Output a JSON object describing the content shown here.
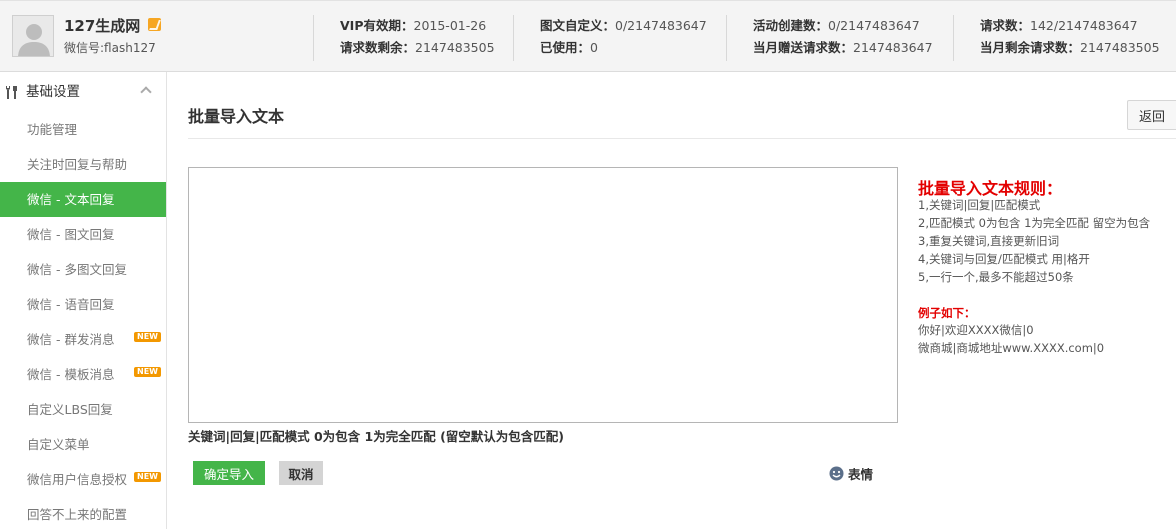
{
  "header": {
    "account_name": "127生成网",
    "wechat_id": "微信号:flash127",
    "stats": [
      [
        {
          "label": "VIP有效期：",
          "value": "2015-01-26"
        },
        {
          "label": "请求数剩余：",
          "value": "2147483505"
        }
      ],
      [
        {
          "label": "图文自定义：",
          "value": "0/2147483647"
        },
        {
          "label": "已使用：",
          "value": "0"
        }
      ],
      [
        {
          "label": "活动创建数：",
          "value": "0/2147483647"
        },
        {
          "label": "当月赠送请求数：",
          "value": "2147483647"
        }
      ],
      [
        {
          "label": "请求数：",
          "value": "142/2147483647"
        },
        {
          "label": "当月剩余请求数：",
          "value": "2147483505"
        }
      ]
    ]
  },
  "sidebar": {
    "section_title": "基础设置",
    "items": [
      {
        "label": "功能管理",
        "badge": "",
        "active": false
      },
      {
        "label": "关注时回复与帮助",
        "badge": "",
        "active": false
      },
      {
        "label": "微信 - 文本回复",
        "badge": "",
        "active": true
      },
      {
        "label": "微信 - 图文回复",
        "badge": "",
        "active": false
      },
      {
        "label": "微信 - 多图文回复",
        "badge": "",
        "active": false
      },
      {
        "label": "微信 - 语音回复",
        "badge": "",
        "active": false
      },
      {
        "label": "微信 - 群发消息",
        "badge": "NEW",
        "active": false
      },
      {
        "label": "微信 - 模板消息",
        "badge": "NEW",
        "active": false
      },
      {
        "label": "自定义LBS回复",
        "badge": "",
        "active": false
      },
      {
        "label": "自定义菜单",
        "badge": "",
        "active": false
      },
      {
        "label": "微信用户信息授权",
        "badge": "NEW",
        "active": false
      },
      {
        "label": "回答不上来的配置",
        "badge": "",
        "active": false
      }
    ]
  },
  "main": {
    "title": "批量导入文本",
    "back_label": "返回",
    "textarea_value": "",
    "hint": "关键词|回复|匹配模式 0为包含 1为完全匹配 (留空默认为包含匹配)",
    "confirm_label": "确定导入",
    "cancel_label": "取消",
    "emoji_label": "表情"
  },
  "rules": {
    "title": "批量导入文本规则：",
    "lines": [
      "1,关键词|回复|匹配模式",
      "2,匹配模式 0为包含 1为完全匹配 留空为包含",
      "3,重复关键词,直接更新旧词",
      "4,关键词与回复/匹配模式 用|格开",
      "5,一行一个,最多不能超过50条"
    ],
    "example_title": "例子如下：",
    "examples": [
      "你好|欢迎XXXX微信|0",
      "微商城|商城地址www.XXXX.com|0"
    ]
  },
  "colors": {
    "accent_green": "#44b549",
    "rule_red": "#e30000",
    "badge_orange": "#f39800"
  }
}
